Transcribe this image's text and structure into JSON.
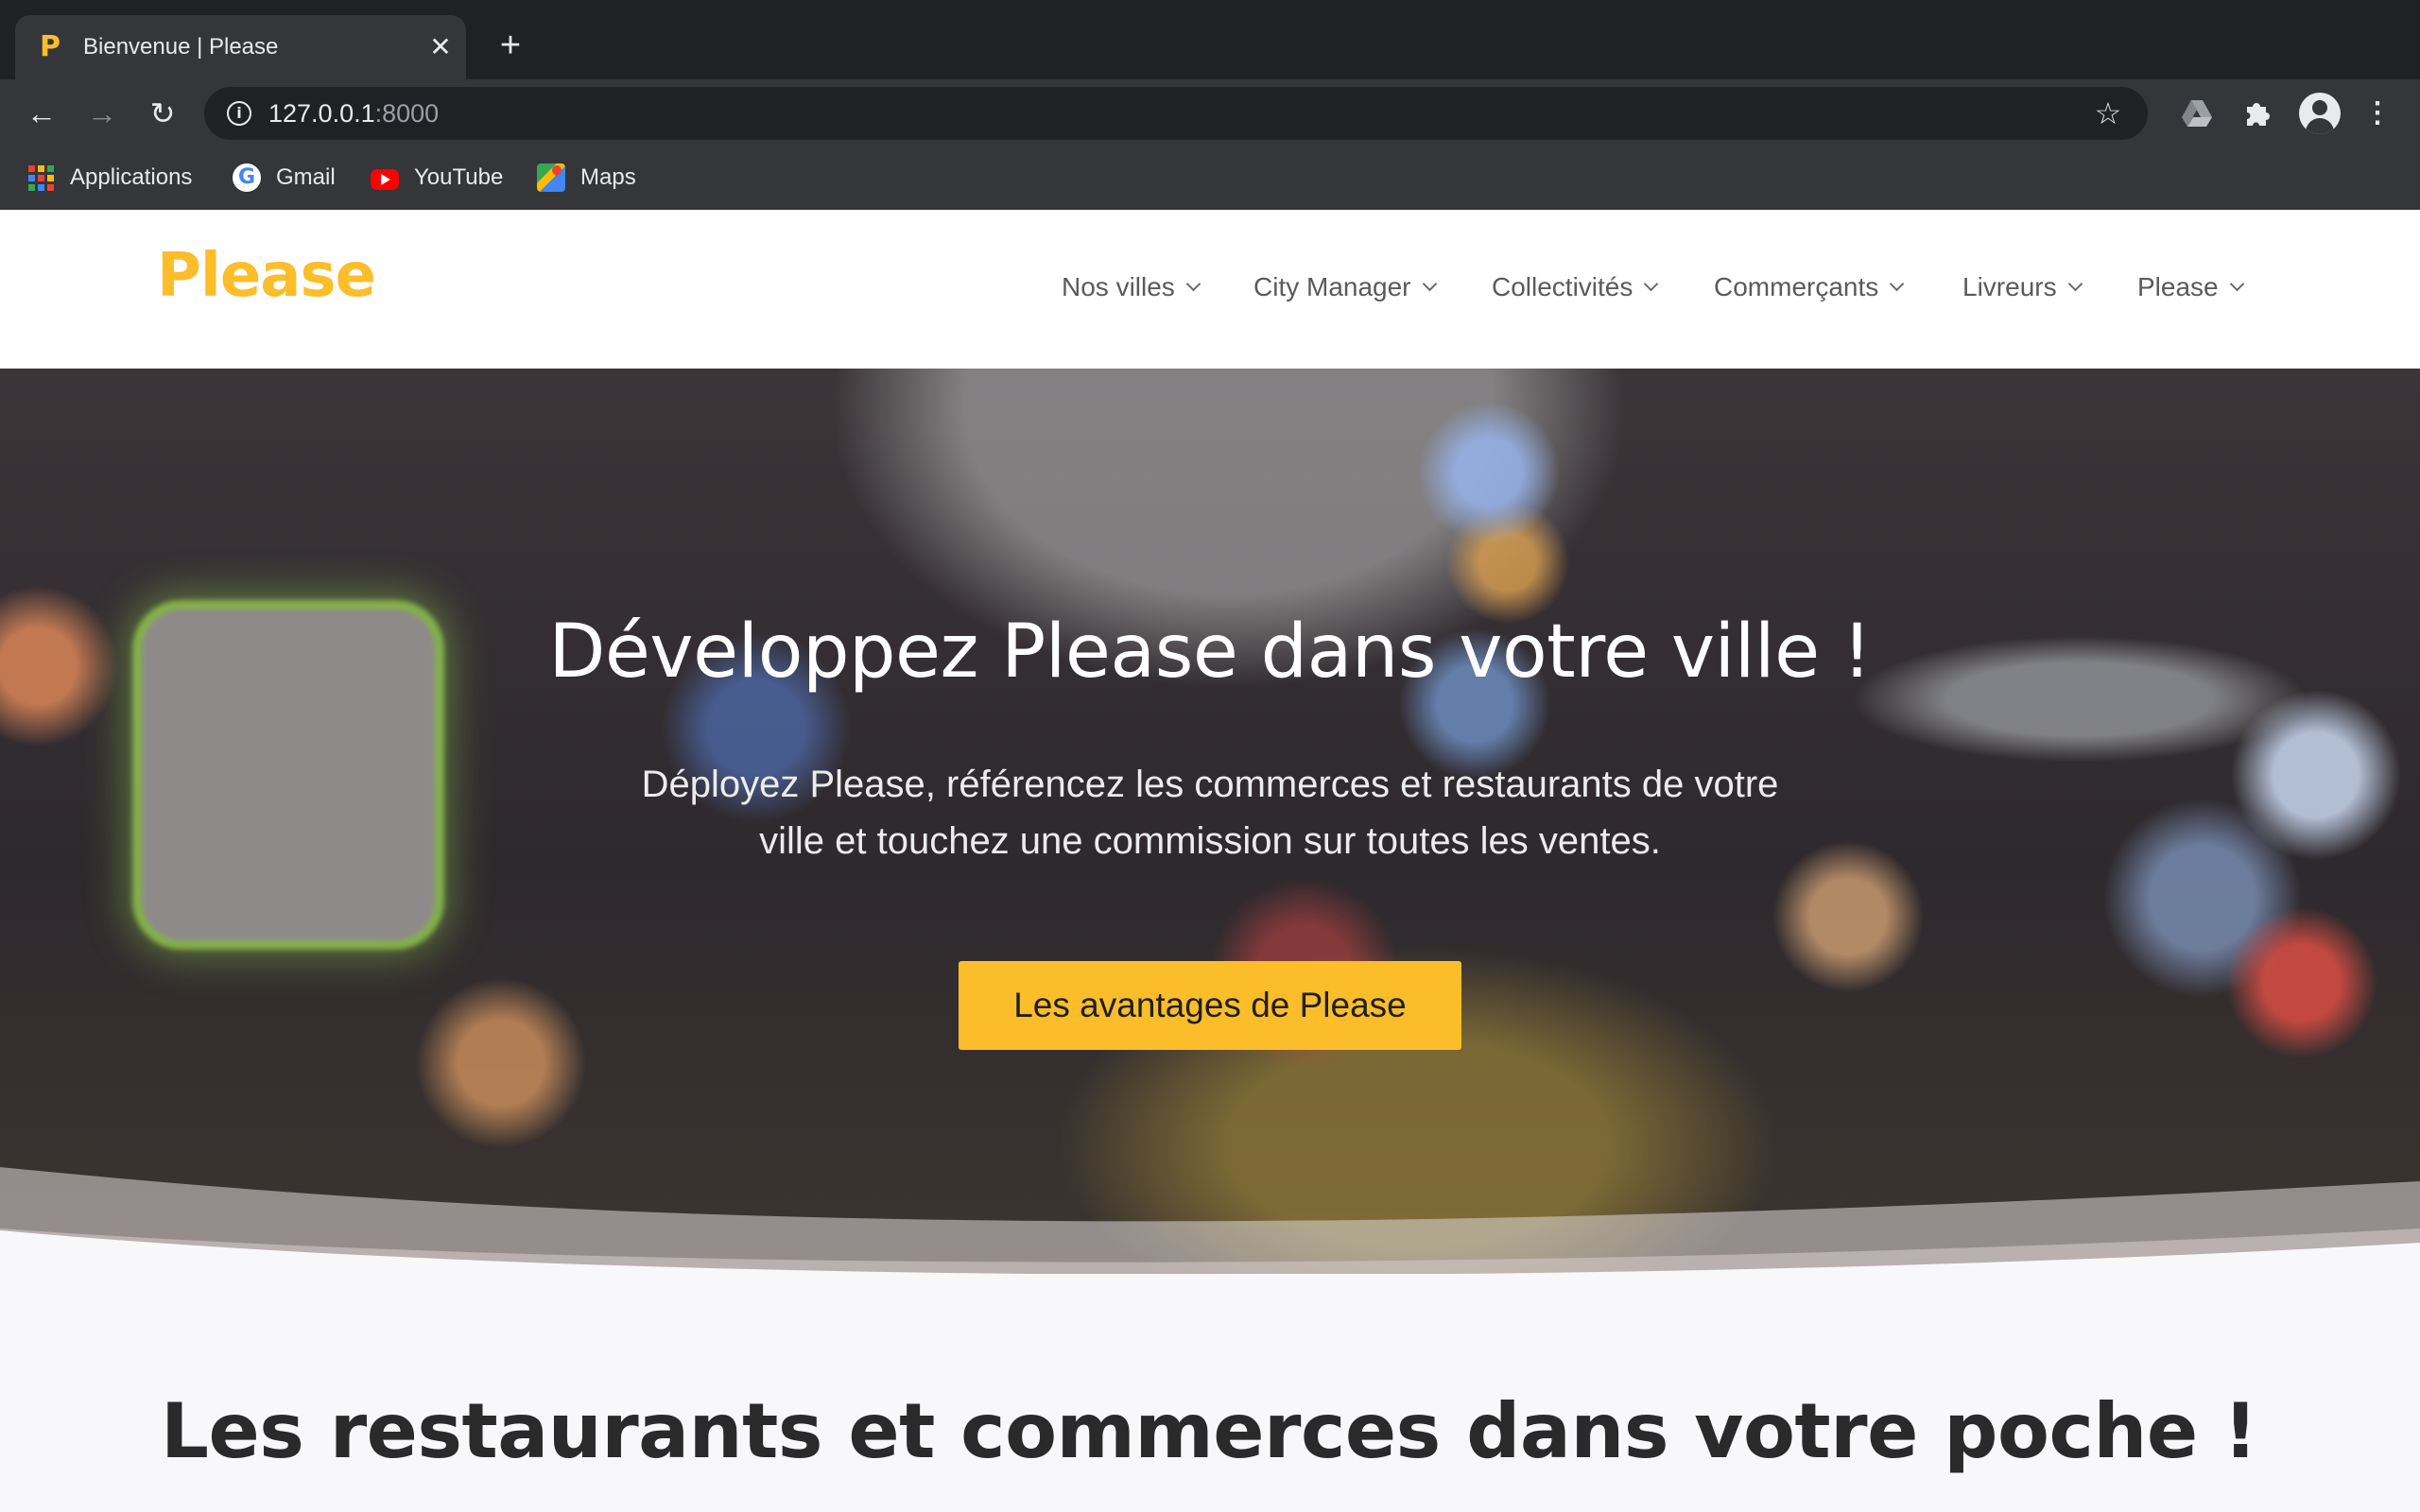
{
  "browser": {
    "tab": {
      "favicon": "P",
      "title": "Bienvenue | Please",
      "close_glyph": "✕"
    },
    "new_tab_glyph": "+",
    "url": {
      "host": "127.0.0.1",
      "port": ":8000"
    },
    "nav": {
      "back": "←",
      "forward": "→",
      "reload": "↻",
      "info": "i",
      "star": "☆"
    },
    "extensions": {
      "drive_icon": "drive-icon",
      "puzzle_icon": "puzzle-icon"
    },
    "menu_glyph": "⋮",
    "bookmarks": [
      {
        "label": "Applications",
        "icon": "apps-grid-icon"
      },
      {
        "label": "Gmail",
        "icon": "google-icon"
      },
      {
        "label": "YouTube",
        "icon": "youtube-icon"
      },
      {
        "label": "Maps",
        "icon": "maps-icon"
      }
    ],
    "accent_color": "#fbbd2a"
  },
  "site": {
    "logo": "Please",
    "nav": [
      {
        "label": "Nos villes"
      },
      {
        "label": "City Manager"
      },
      {
        "label": "Collectivités"
      },
      {
        "label": "Commerçants"
      },
      {
        "label": "Livreurs"
      },
      {
        "label": "Please"
      }
    ],
    "hero": {
      "title": "Développez Please dans votre ville !",
      "subtitle_line1": "Déployez Please, référencez les commerces et restaurants de votre",
      "subtitle_line2": "ville et touchez une commission sur toutes les ventes.",
      "cta": "Les avantages de Please"
    },
    "section_title": "Les restaurants et commerces dans votre poche !",
    "brand_color": "#fbbd2a"
  }
}
